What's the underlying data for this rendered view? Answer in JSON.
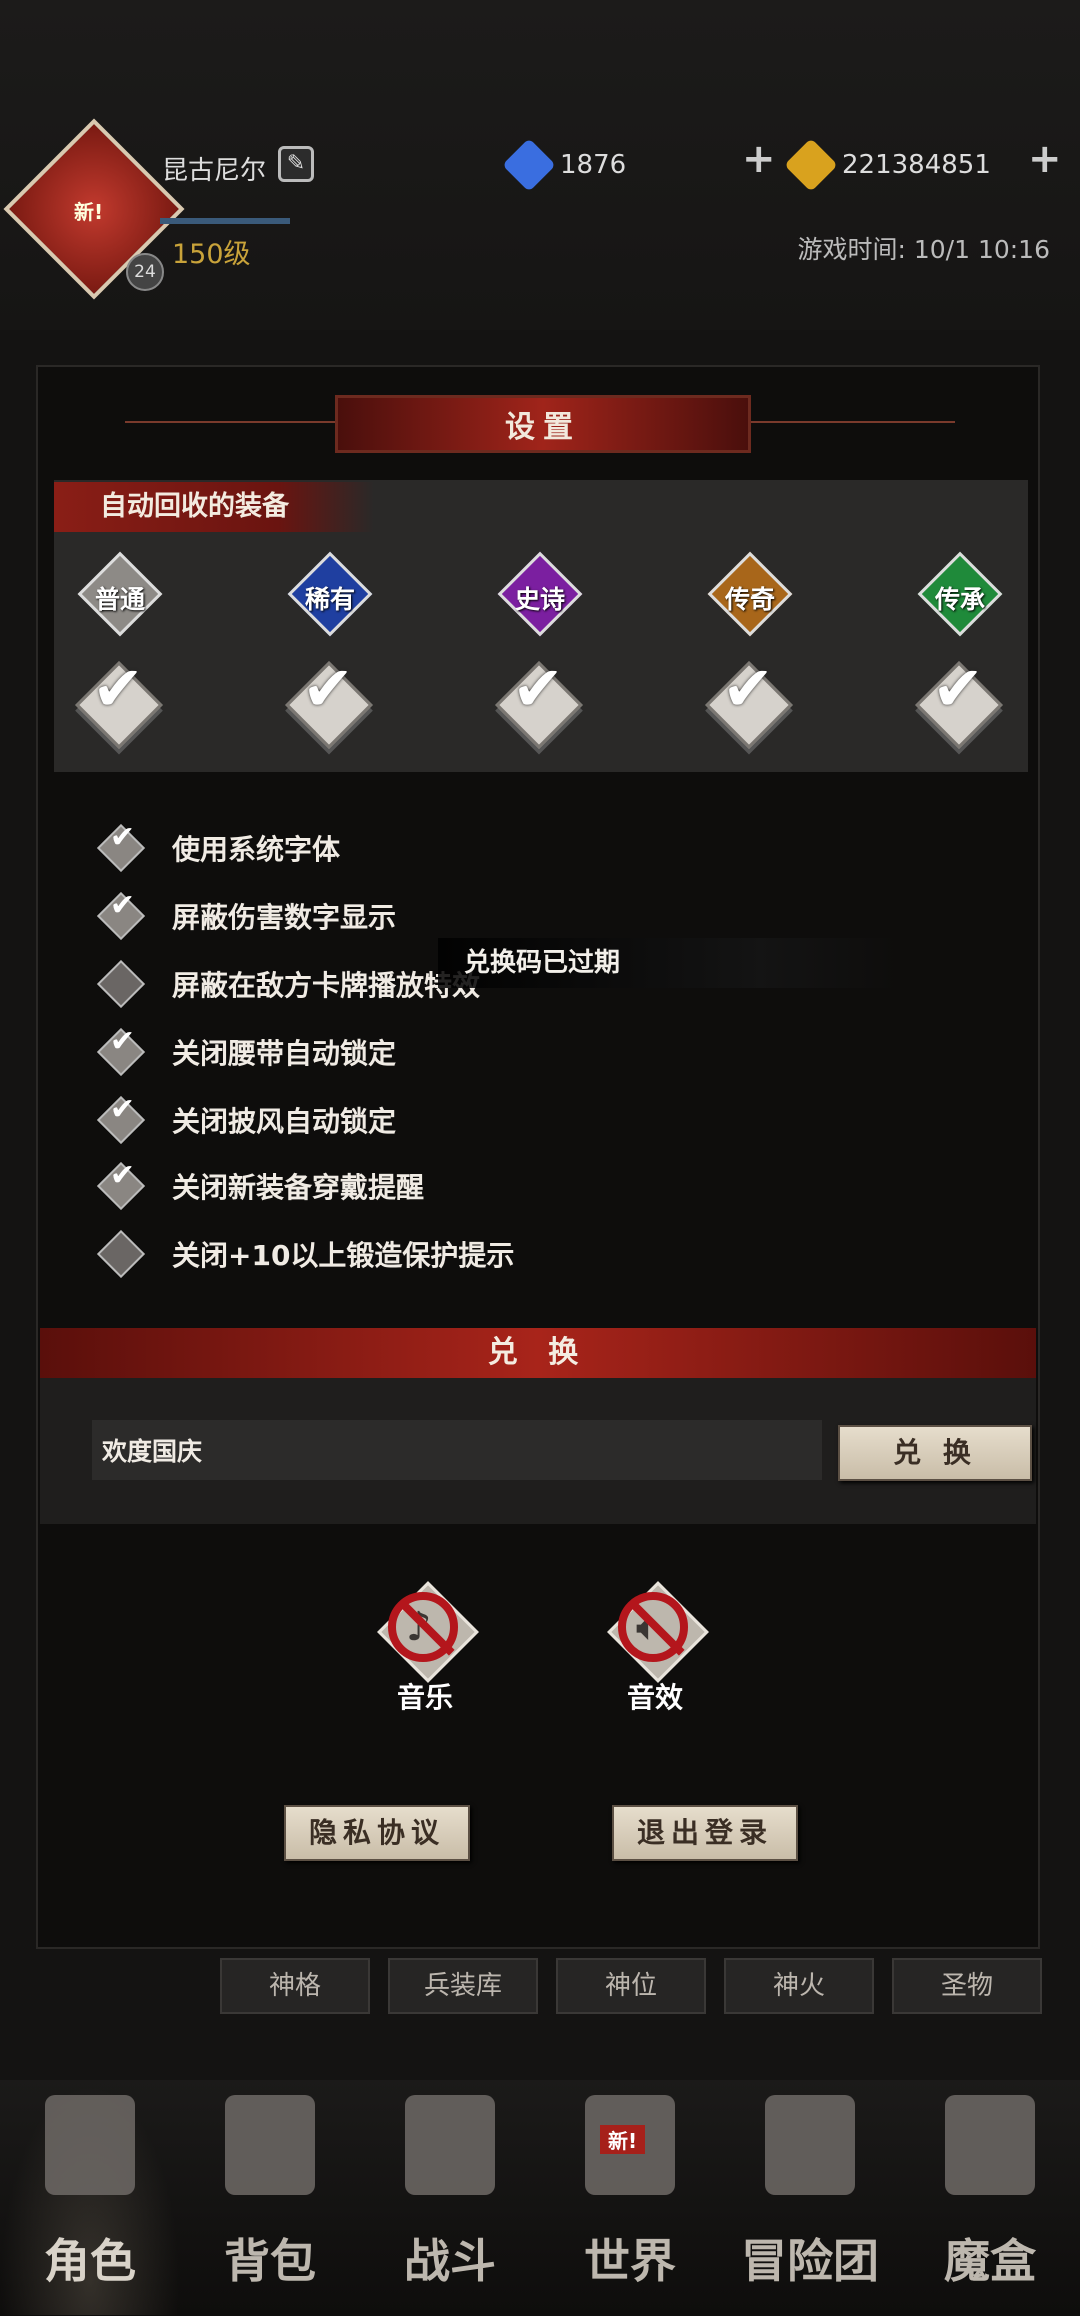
{
  "player": {
    "name": "昆古尼尔",
    "level": "150级",
    "avatar_badge": "新!",
    "avatar_level": "24"
  },
  "currency": [
    {
      "icon": "blue-gem-icon",
      "value": "1876",
      "color": "#3a6ee0"
    },
    {
      "icon": "gold-gem-icon",
      "value": "221384851",
      "color": "#d9a21e"
    }
  ],
  "game_time": "游戏时间: 10/1 10:16",
  "settings": {
    "title": "设置",
    "auto_recycle": {
      "heading": "自动回收的装备",
      "rarities": [
        {
          "label": "普通",
          "color": "#8d8a86",
          "checked": true
        },
        {
          "label": "稀有",
          "color": "#1f3fa0",
          "checked": true
        },
        {
          "label": "史诗",
          "color": "#7b1fa0",
          "checked": true
        },
        {
          "label": "传奇",
          "color": "#a8661a",
          "checked": true
        },
        {
          "label": "传承",
          "color": "#1f8a3a",
          "checked": true
        }
      ]
    },
    "options": [
      {
        "label": "使用系统字体",
        "checked": true
      },
      {
        "label": "屏蔽伤害数字显示",
        "checked": true
      },
      {
        "label": "屏蔽在敌方卡牌播放特效",
        "checked": false
      },
      {
        "label": "关闭腰带自动锁定",
        "checked": true
      },
      {
        "label": "关闭披风自动锁定",
        "checked": true
      },
      {
        "label": "关闭新装备穿戴提醒",
        "checked": true
      },
      {
        "label": "关闭+10以上锻造保护提示",
        "checked": false
      }
    ],
    "toast": "兑换码已过期",
    "redeem": {
      "heading": "兑 换",
      "code_value": "欢度国庆",
      "button": "兑 换"
    },
    "sound": [
      {
        "label": "音乐",
        "icon": "music-muted-icon"
      },
      {
        "label": "音效",
        "icon": "sfx-muted-icon"
      }
    ],
    "privacy_button": "隐私协议",
    "logout_button": "退出登录"
  },
  "sub_tabs": [
    "神格",
    "兵装库",
    "神位",
    "神火",
    "圣物"
  ],
  "bottom_nav": [
    {
      "label": "角色",
      "icon": "helmet-icon",
      "active": true
    },
    {
      "label": "背包",
      "icon": "backpack-icon"
    },
    {
      "label": "战斗",
      "icon": "sword-shield-icon"
    },
    {
      "label": "世界",
      "icon": "scroll-map-icon",
      "badge": "新!"
    },
    {
      "label": "冒险团",
      "icon": "castle-icon"
    },
    {
      "label": "魔盒",
      "icon": "cube-icon"
    }
  ]
}
